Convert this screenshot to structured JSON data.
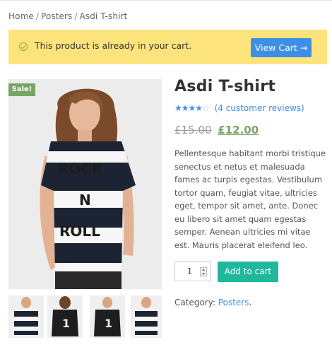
{
  "breadcrumb": {
    "home": "Home",
    "category": "Posters",
    "current": "Asdi T-shirt",
    "separator": "/"
  },
  "notice": {
    "message": "This product is already in your cart.",
    "button_label": "View Cart →",
    "icon": "check-circle-icon",
    "background": "#fde37b"
  },
  "gallery": {
    "sale_badge": "Sale!",
    "main_image": {
      "alt": "Woman wearing a striped ROCK N ROLL t-shirt",
      "print_lines": [
        "ROCK",
        "N",
        "ROLL"
      ]
    },
    "thumbnails": [
      {
        "alt": "Striped t-shirt front"
      },
      {
        "alt": "Black t-shirt with number 1 back"
      },
      {
        "alt": "Black t-shirt with number 1 front"
      },
      {
        "alt": "Striped t-shirt side"
      }
    ]
  },
  "product": {
    "title": "Asdi T-shirt",
    "rating": {
      "value": 4,
      "max": 5,
      "reviews_text": "(4 customer reviews)"
    },
    "price": {
      "old": "£15.00",
      "new": "£12.00"
    },
    "description": "Pellentesque habitant morbi tristique senectus et netus et malesuada fames ac turpis egestas. Vestibulum tortor quam, feugiat vitae, ultricies eget, tempor sit amet, ante. Donec eu libero sit amet quam egestas semper. Aenean ultricies mi vitae est. Mauris placerat eleifend leo.",
    "quantity": "1",
    "add_to_cart_label": "Add to cart",
    "category_label": "Category:",
    "category_value": "Posters",
    "category_suffix": "."
  },
  "colors": {
    "accent_blue": "#3f8ee6",
    "add_to_cart_green": "#1fb89c",
    "sale_green": "#77a464"
  }
}
